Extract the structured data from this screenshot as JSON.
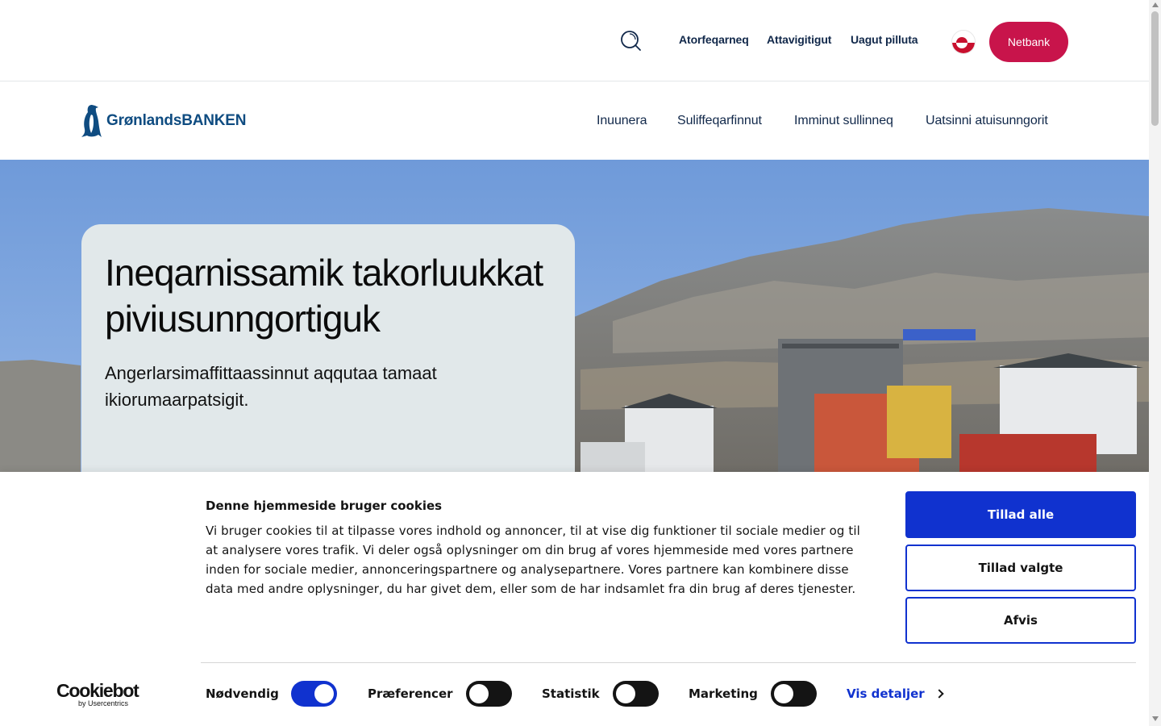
{
  "topbar": {
    "links": [
      "Atorfeqarneq",
      "Attavigitigut",
      "Uagut pilluta"
    ],
    "netbank_label": "Netbank",
    "search_icon": "search-icon",
    "language_icon": "greenland-flag-icon"
  },
  "brand": {
    "logo_text": "GrønlandsBANKEN",
    "logo_icon": "penguin-logo-icon",
    "color": "#0f4c81"
  },
  "nav": {
    "items": [
      "Inuunera",
      "Suliffeqarfinnut",
      "Imminut sullinneq",
      "Uatsinni atuisunngorit"
    ]
  },
  "hero": {
    "title": "Ineqarnissamik takorluukkat piviusunngortiguk",
    "subtitle": "Angerlarsimaffittaassinnut aqqutaa tamaat ikiorumaarpatsigit."
  },
  "cookie": {
    "title": "Denne hjemmeside bruger cookies",
    "body": "Vi bruger cookies til at tilpasse vores indhold og annoncer, til at vise dig funktioner til sociale medier og til at analysere vores trafik. Vi deler også oplysninger om din brug af vores hjemmeside med vores partnere inden for sociale medier, annonceringspartnere og analysepartnere. Vores partnere kan kombinere disse data med andre oplysninger, du har givet dem, eller som de har indsamlet fra din brug af deres tjenester.",
    "buttons": {
      "allow_all": "Tillad alle",
      "allow_selected": "Tillad valgte",
      "reject": "Afvis"
    },
    "toggles": [
      {
        "label": "Nødvendig",
        "on": true
      },
      {
        "label": "Præferencer",
        "on": false
      },
      {
        "label": "Statistik",
        "on": false
      },
      {
        "label": "Marketing",
        "on": false
      }
    ],
    "details_label": "Vis detaljer",
    "provider": {
      "name": "Cookiebot",
      "by": "by Usercentrics"
    }
  },
  "colors": {
    "netbank": "#c8144b",
    "cookie_primary": "#1032cf",
    "hero_card": "#e1e8ea"
  }
}
